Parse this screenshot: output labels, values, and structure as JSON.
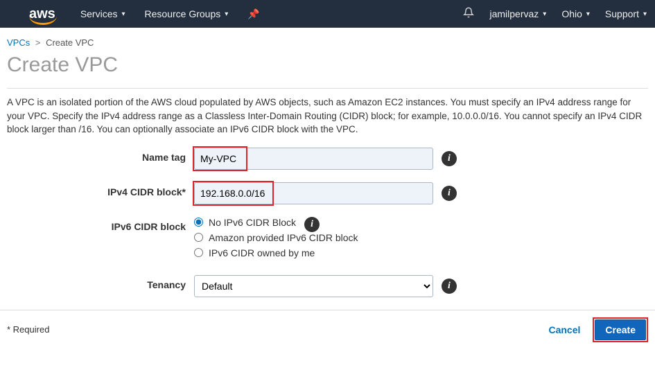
{
  "topnav": {
    "logo": "aws",
    "services": "Services",
    "resource_groups": "Resource Groups",
    "user": "jamilpervaz",
    "region": "Ohio",
    "support": "Support"
  },
  "breadcrumbs": {
    "root": "VPCs",
    "current": "Create VPC"
  },
  "page": {
    "title": "Create VPC",
    "description": "A VPC is an isolated portion of the AWS cloud populated by AWS objects, such as Amazon EC2 instances. You must specify an IPv4 address range for your VPC. Specify the IPv4 address range as a Classless Inter-Domain Routing (CIDR) block; for example, 10.0.0.0/16. You cannot specify an IPv4 CIDR block larger than /16. You can optionally associate an IPv6 CIDR block with the VPC."
  },
  "form": {
    "name_tag": {
      "label": "Name tag",
      "value": "My-VPC"
    },
    "ipv4_cidr": {
      "label": "IPv4 CIDR block*",
      "value": "192.168.0.0/16"
    },
    "ipv6_cidr": {
      "label": "IPv6 CIDR block",
      "selected": "none",
      "options": {
        "none": "No IPv6 CIDR Block",
        "amazon": "Amazon provided IPv6 CIDR block",
        "owned": "IPv6 CIDR owned by me"
      }
    },
    "tenancy": {
      "label": "Tenancy",
      "selected": "Default"
    }
  },
  "footer": {
    "required_note": "* Required",
    "cancel": "Cancel",
    "create": "Create"
  },
  "icons": {
    "info": "i"
  }
}
